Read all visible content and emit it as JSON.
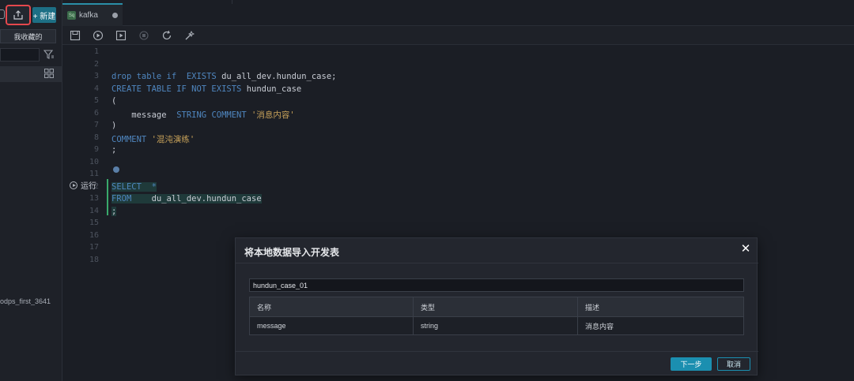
{
  "sidebar": {
    "new_button": "+ 新建",
    "favorites_button": "我收藏的",
    "search_placeholder": "",
    "tree_item": "odps_first_3641"
  },
  "tabs": [
    {
      "label": "kafka",
      "icon_text": "Sq"
    }
  ],
  "editor": {
    "line_numbers": [
      "1",
      "2",
      "3",
      "4",
      "5",
      "6",
      "7",
      "8",
      "9",
      "10",
      "11",
      "12",
      "13",
      "14",
      "15",
      "16",
      "17",
      "18"
    ],
    "run_label": "运行",
    "lines": [
      {
        "segments": []
      },
      {
        "segments": []
      },
      {
        "segments": [
          {
            "t": "drop table if  EXISTS ",
            "c": "kw"
          },
          {
            "t": "du_all_dev.hundun_case;",
            "c": ""
          }
        ]
      },
      {
        "segments": [
          {
            "t": "CREATE TABLE IF NOT EXISTS ",
            "c": "kw"
          },
          {
            "t": "hundun_case",
            "c": ""
          }
        ]
      },
      {
        "segments": [
          {
            "t": "(",
            "c": ""
          }
        ]
      },
      {
        "segments": [
          {
            "t": "    message  ",
            "c": ""
          },
          {
            "t": "STRING COMMENT ",
            "c": "kw"
          },
          {
            "t": "'消息内容'",
            "c": "str"
          }
        ]
      },
      {
        "segments": [
          {
            "t": ")",
            "c": ""
          }
        ]
      },
      {
        "segments": [
          {
            "t": "COMMENT ",
            "c": "kw"
          },
          {
            "t": "'混沌演练'",
            "c": "str"
          }
        ]
      },
      {
        "segments": [
          {
            "t": ";",
            "c": ""
          }
        ]
      },
      {
        "segments": []
      },
      {
        "segments": []
      },
      {
        "segments": [
          {
            "t": "SELECT  *",
            "c": "kw"
          }
        ],
        "selected": true
      },
      {
        "segments": [
          {
            "t": "FROM    ",
            "c": "kw"
          },
          {
            "t": "du_all_dev.hundun_case",
            "c": ""
          }
        ],
        "selected": true
      },
      {
        "segments": [
          {
            "t": ";",
            "c": ""
          }
        ],
        "selected": true
      },
      {
        "segments": []
      },
      {
        "segments": []
      },
      {
        "segments": []
      },
      {
        "segments": []
      }
    ]
  },
  "dialog": {
    "title": "将本地数据导入开发表",
    "table_name": "hundun_case_01",
    "columns": {
      "name": "名称",
      "type": "类型",
      "desc": "描述"
    },
    "rows": [
      {
        "name": "message",
        "type": "string",
        "desc": "消息内容"
      }
    ],
    "next_button": "下一步",
    "cancel_button": "取消",
    "close_icon": "close-icon"
  },
  "colors": {
    "accent": "#1b8fb0",
    "highlight_border": "#e5484d",
    "keyword": "#4f86bf",
    "string": "#c9a35a"
  }
}
